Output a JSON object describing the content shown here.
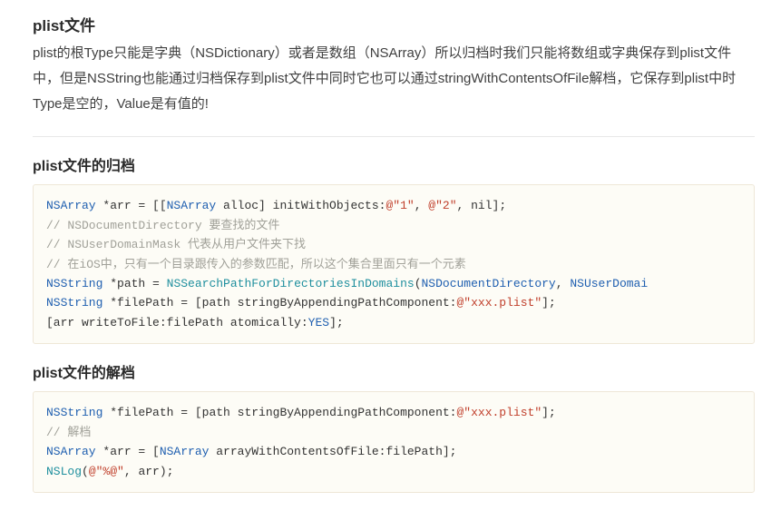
{
  "section_title": "plist文件",
  "description": "plist的根Type只能是字典（NSDictionary）或者是数组（NSArray）所以归档时我们只能将数组或字典保存到plist文件中，但是NSString也能通过归档保存到plist文件中同时它也可以通过stringWithContentsOfFile解档，它保存到plist中时Type是空的，Value是有值的!",
  "archive_title": "plist文件的归档",
  "archive_code_html": "<span class=\"tok-type\">NSArray</span> *arr = [[<span class=\"tok-type\">NSArray</span> alloc] initWithObjects:<span class=\"tok-str\">@\"1\"</span>, <span class=\"tok-str\">@\"2\"</span>, nil];\n<span class=\"tok-comm\">// NSDocumentDirectory 要查找的文件</span>\n<span class=\"tok-comm\">// NSUserDomainMask 代表从用户文件夹下找</span>\n<span class=\"tok-comm\">// 在iOS中，只有一个目录跟传入的参数匹配，所以这个集合里面只有一个元素</span>\n<span class=\"tok-type\">NSString</span> *path = <span class=\"tok-func\">NSSearchPathForDirectoriesInDomains</span>(<span class=\"tok-const\">NSDocumentDirectory</span>, <span class=\"tok-const\">NSUserDomai</span>\n<span class=\"tok-type\">NSString</span> *filePath = [path stringByAppendingPathComponent:<span class=\"tok-str\">@\"xxx.plist\"</span>];\n[arr writeToFile:filePath atomically:<span class=\"tok-const\">YES</span>];",
  "unarchive_title": "plist文件的解档",
  "unarchive_code_html": "<span class=\"tok-type\">NSString</span> *filePath = [path stringByAppendingPathComponent:<span class=\"tok-str\">@\"xxx.plist\"</span>];\n<span class=\"tok-comm\">// 解档</span>\n<span class=\"tok-type\">NSArray</span> *arr = [<span class=\"tok-type\">NSArray</span> arrayWithContentsOfFile:filePath];\n<span class=\"tok-func\">NSLog</span>(<span class=\"tok-str\">@\"%@\"</span>, arr);"
}
